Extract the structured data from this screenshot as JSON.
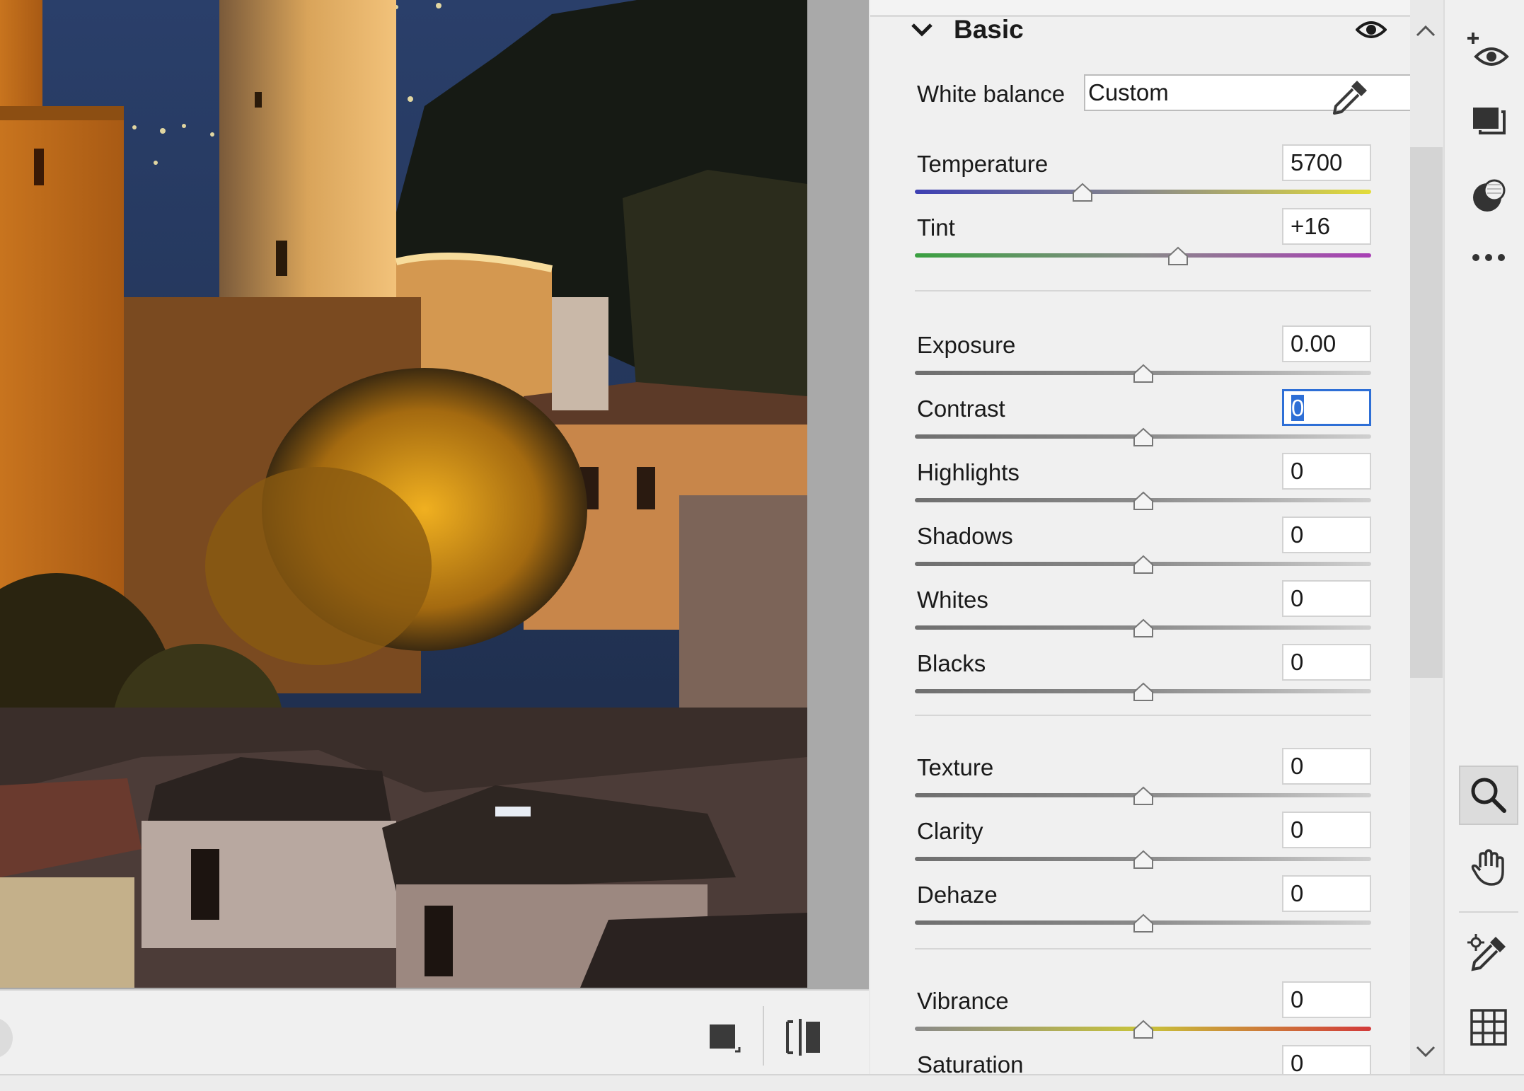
{
  "panel": {
    "section_title": "Basic",
    "white_balance": {
      "label": "White balance",
      "value": "Custom"
    },
    "sliders": [
      {
        "key": "temperature",
        "label": "Temperature",
        "value": "5700",
        "position": 0.367,
        "track": "temperature"
      },
      {
        "key": "tint",
        "label": "Tint",
        "value": "+16",
        "position": 0.576,
        "track": "tint"
      },
      {
        "key": "exposure",
        "label": "Exposure",
        "value": "0.00",
        "position": 0.5,
        "track": "neutral"
      },
      {
        "key": "contrast",
        "label": "Contrast",
        "value": "0",
        "position": 0.5,
        "track": "neutral",
        "focused": true
      },
      {
        "key": "highlights",
        "label": "Highlights",
        "value": "0",
        "position": 0.5,
        "track": "neutral"
      },
      {
        "key": "shadows",
        "label": "Shadows",
        "value": "0",
        "position": 0.5,
        "track": "neutral"
      },
      {
        "key": "whites",
        "label": "Whites",
        "value": "0",
        "position": 0.5,
        "track": "neutral"
      },
      {
        "key": "blacks",
        "label": "Blacks",
        "value": "0",
        "position": 0.5,
        "track": "neutral"
      },
      {
        "key": "texture",
        "label": "Texture",
        "value": "0",
        "position": 0.5,
        "track": "neutral"
      },
      {
        "key": "clarity",
        "label": "Clarity",
        "value": "0",
        "position": 0.5,
        "track": "neutral"
      },
      {
        "key": "dehaze",
        "label": "Dehaze",
        "value": "0",
        "position": 0.5,
        "track": "neutral"
      },
      {
        "key": "vibrance",
        "label": "Vibrance",
        "value": "0",
        "position": 0.5,
        "track": "vibrance"
      },
      {
        "key": "saturation",
        "label": "Saturation",
        "value": "0",
        "position": 0.5,
        "track": "vibrance"
      }
    ]
  },
  "right_toolbar": {
    "tools": [
      "add-mask-icon",
      "presets-icon",
      "healing-icon",
      "more-icon",
      "zoom-icon",
      "hand-icon",
      "color-sampler-icon",
      "grid-icon"
    ],
    "active_tool": "zoom-icon"
  },
  "bottom_toolbar": {
    "tools": [
      "single-view-icon",
      "compare-view-icon"
    ]
  },
  "colors": {
    "panel_bg": "#f0f0f0",
    "accent_focus": "#2e6fd6",
    "temperature_track": [
      "#3d3fb3",
      "#8a8a8a",
      "#e3dc3a"
    ],
    "tint_track": [
      "#3aa040",
      "#8a8a8a",
      "#a83fb5"
    ],
    "vibrance_track": [
      "#8a8a8a",
      "#c8c43a",
      "#d23a3a"
    ]
  }
}
